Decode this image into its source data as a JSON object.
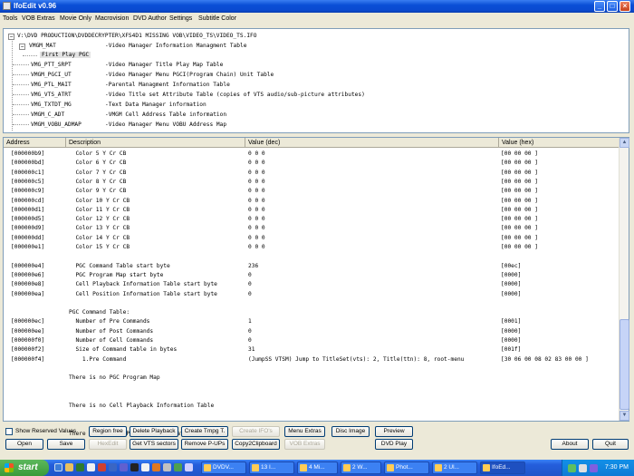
{
  "window": {
    "title": "IfoEdit v0.96"
  },
  "menu": [
    "Tools",
    "VOB Extras",
    "Movie Only",
    "Macrovision",
    "DVD Author",
    "Settings",
    "Subtitle Color"
  ],
  "tree": {
    "root": "V:\\DVD PRODUCTION\\DVDDECRYPTER\\XFS4D1 MISSING VOB\\VIDEO_TS\\VIDEO_TS.IFO",
    "items": [
      {
        "name": "VMGM_MAT",
        "desc": "-Video Manager Information Managment Table"
      },
      {
        "name": "First Play PGC",
        "desc": ""
      },
      {
        "name": "VMG_PTT_SRPT",
        "desc": "-Video Manager Title Play Map Table"
      },
      {
        "name": "VMGM_PGCI_UT",
        "desc": "-Video Manager Menu PGCI(Program Chain) Unit Table"
      },
      {
        "name": "VMG_PTL_MAIT",
        "desc": "-Parental Managment Information Table"
      },
      {
        "name": "VMG_VTS_ATRT",
        "desc": "-Video Title set Attribute Table (copies of VTS audio/sub-picture attributes)"
      },
      {
        "name": "VMG_TXTDT_MG",
        "desc": "-Text Data Manager information"
      },
      {
        "name": "VMGM_C_ADT",
        "desc": "-VMGM Cell Address Table information"
      },
      {
        "name": "VMGM_VOBU_ADMAP",
        "desc": "-Video Manager Menu VOBU Address Map"
      }
    ]
  },
  "table": {
    "headers": [
      "Address",
      "Description",
      "Value (dec)",
      "Value (hex)"
    ],
    "rows": [
      [
        "[000000b9]",
        "  Color 5 Y Cr CB",
        "0 0 0",
        "[00 00 00 ]"
      ],
      [
        "[000000bd]",
        "  Color 6 Y Cr CB",
        "0 0 0",
        "[00 00 00 ]"
      ],
      [
        "[000000c1]",
        "  Color 7 Y Cr CB",
        "0 0 0",
        "[00 00 00 ]"
      ],
      [
        "[000000c5]",
        "  Color 8 Y Cr CB",
        "0 0 0",
        "[00 00 00 ]"
      ],
      [
        "[000000c9]",
        "  Color 9 Y Cr CB",
        "0 0 0",
        "[00 00 00 ]"
      ],
      [
        "[000000cd]",
        "  Color 10 Y Cr CB",
        "0 0 0",
        "[00 00 00 ]"
      ],
      [
        "[000000d1]",
        "  Color 11 Y Cr CB",
        "0 0 0",
        "[00 00 00 ]"
      ],
      [
        "[000000d5]",
        "  Color 12 Y Cr CB",
        "0 0 0",
        "[00 00 00 ]"
      ],
      [
        "[000000d9]",
        "  Color 13 Y Cr CB",
        "0 0 0",
        "[00 00 00 ]"
      ],
      [
        "[000000dd]",
        "  Color 14 Y Cr CB",
        "0 0 0",
        "[00 00 00 ]"
      ],
      [
        "[000000e1]",
        "  Color 15 Y Cr CB",
        "0 0 0",
        "[00 00 00 ]"
      ],
      [
        "",
        "",
        "",
        ""
      ],
      [
        "[000000e4]",
        "  PGC Command Table start byte",
        "236",
        "[00ec]"
      ],
      [
        "[000000e6]",
        "  PGC Program Map start byte",
        "0",
        "[0000]"
      ],
      [
        "[000000e8]",
        "  Cell Playback Information Table start byte",
        "0",
        "[0000]"
      ],
      [
        "[000000ea]",
        "  Cell Position Information Table start byte",
        "0",
        "[0000]"
      ],
      [
        "",
        "",
        "",
        ""
      ],
      [
        "",
        "PGC Command Table:",
        "",
        ""
      ],
      [
        "[000000ec]",
        "  Number of Pre Commands",
        "1",
        "[0001]"
      ],
      [
        "[000000ee]",
        "  Number of Post Commands",
        "0",
        "[0000]"
      ],
      [
        "[000000f0]",
        "  Number of Cell Commands",
        "0",
        "[0000]"
      ],
      [
        "[000000f2]",
        "  Size of Command table in bytes",
        "31",
        "[001f]"
      ],
      [
        "[000000f4]",
        "    1.Pre Command",
        "(JumpSS VTSM) Jump to TitleSet(vts): 2, Title(ttn): 8, root-menu",
        "[30 06 00 08 02 83 00 00 ]"
      ],
      [
        "",
        "",
        "",
        ""
      ],
      [
        "",
        "There is no PGC Program Map",
        "",
        ""
      ],
      [
        "",
        "",
        "",
        ""
      ],
      [
        "",
        "",
        "",
        ""
      ],
      [
        "",
        "There is no Cell Playback Information Table",
        "",
        ""
      ],
      [
        "",
        "",
        "",
        ""
      ],
      [
        "",
        "",
        "",
        ""
      ],
      [
        "",
        "There is no Cell Position Information Table",
        "",
        ""
      ]
    ]
  },
  "buttons": {
    "show_reserved": "Show Reserved Values",
    "region_free": "Region free",
    "delete_playback": "Delete Playback",
    "create_tmpg": "Create Tmpg T.",
    "create_ifos": "Create IFO's",
    "menu_extras": "Menu Extras",
    "disc_image": "Disc Image",
    "preview": "Preview",
    "open": "Open",
    "save": "Save",
    "hexedit": "HexEdit",
    "get_vts": "Get VTS sectors",
    "remove_pups": "Remove P-UPs",
    "copy_clipboard": "Copy2Clipboard",
    "vob_extras": "VOB Extras",
    "dvd_play": "DVD Play",
    "about": "About",
    "quit": "Quit"
  },
  "taskbar": {
    "start": "start",
    "tasks": [
      "DVDV...",
      "13 I...",
      "4 Mi...",
      "2 W...",
      "Phot...",
      "2 Ul...",
      "IfoEd..."
    ],
    "clock": "7:30 PM"
  }
}
